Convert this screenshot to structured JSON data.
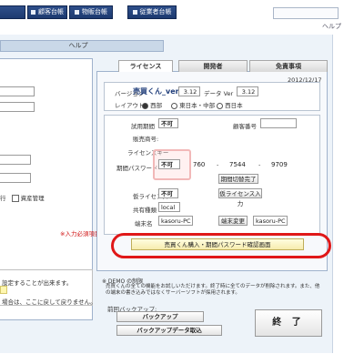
{
  "top_tabs": [
    "",
    "顧客台帳",
    "物販台帳",
    "従業者台帳"
  ],
  "help_top": "ヘルプ",
  "left_tab_help": "ヘルプ",
  "tabs": [
    "ライセンス",
    "開発者",
    "免責事項"
  ],
  "date": "2012/12/17",
  "version": {
    "label": "バージョン",
    "product": "売買くん_ver",
    "num": "3.12",
    "data_label": "データ Ver",
    "data_num": "3.12"
  },
  "region": {
    "label": "レイアウト:",
    "options": [
      "西部",
      "東日本・中部",
      "西日本"
    ]
  },
  "left_fields": {
    "trial_label": "試用期間",
    "trial_value": "不可",
    "customer_label": "顧客番号",
    "serial_label": "販売商号:",
    "key_label": "ライセンスキー"
  },
  "period_pw": {
    "label": "期間パスワード",
    "status": "不可",
    "parts": [
      "760",
      "7544",
      "9709"
    ],
    "change_button": "期間切替完了"
  },
  "temp_license": {
    "label": "仮ライセンス",
    "value": "不可",
    "button": "仮ライセンス入力"
  },
  "shared": {
    "label": "共有種類",
    "value": "local"
  },
  "terminal": {
    "label": "端末名",
    "value": "kasoru-PC",
    "button": "端末変更",
    "value2": "kasoru-PC"
  },
  "purchase_button": "売買くん購入・期間パスワード確認画面",
  "demo": {
    "title": "※ DEMO の制限",
    "text": "売買くんの全ての機能をお試しいただけます。終了時に全てのデータが削除されます。また、他の端末の書き込みではなくサーバーソフトが採用されます。"
  },
  "left_texts": {
    "checkbox1": "行",
    "checkbox2": "資産管理",
    "red_note": "※入力必須項目",
    "note1": "設定することが出来ます。",
    "note2": "場合は、ここに戻して戻りません。"
  },
  "backup": {
    "label": "前回バックアップ:",
    "backup_button": "バックアップ",
    "restore_button": "バックアップデータ取込"
  },
  "exit_button": "終 了"
}
